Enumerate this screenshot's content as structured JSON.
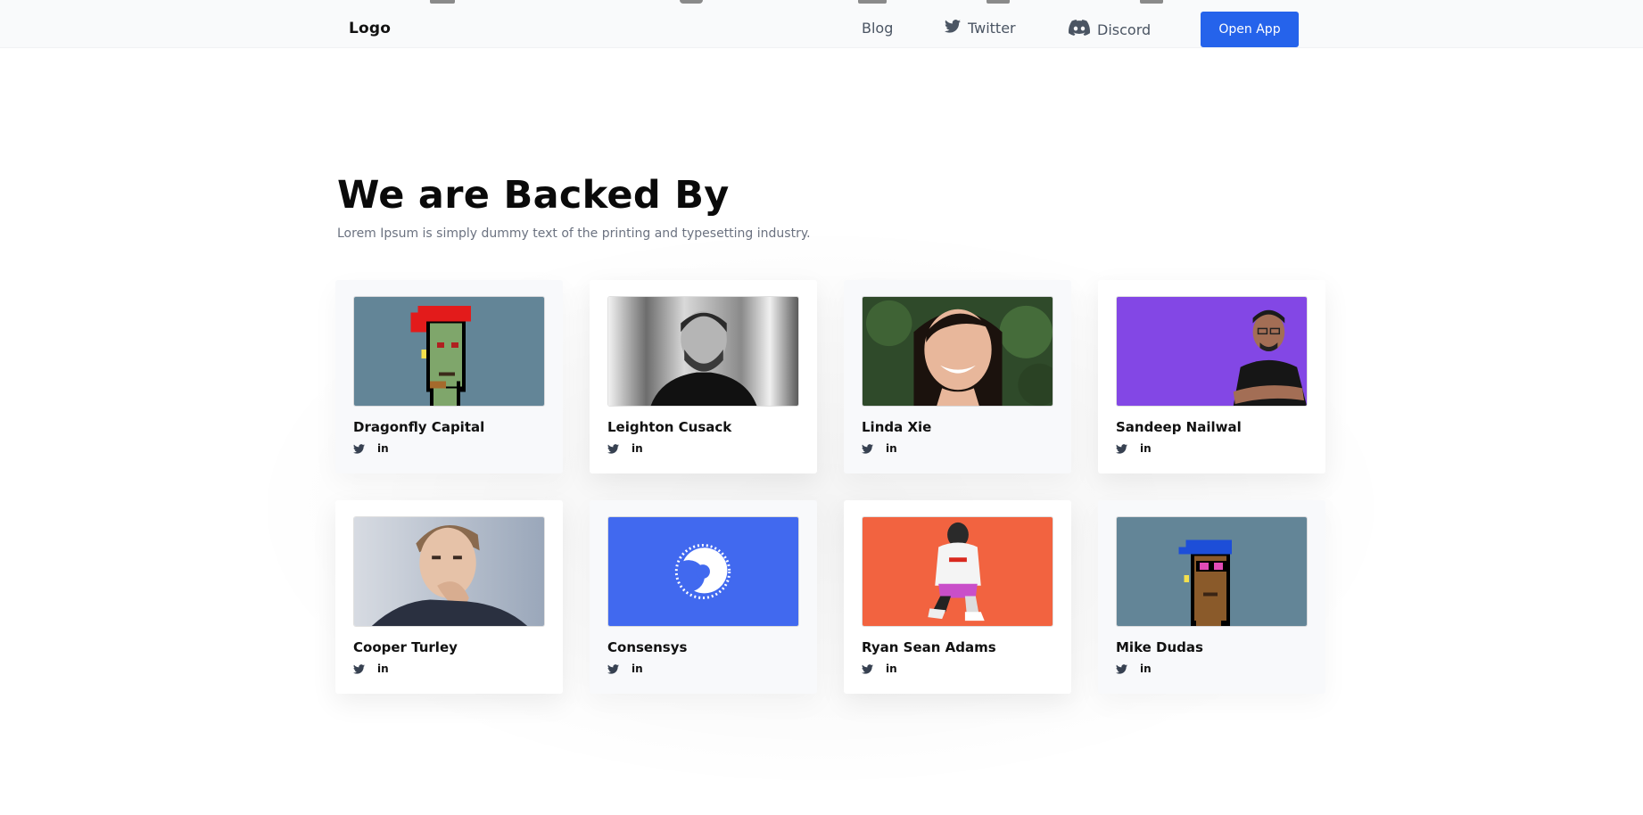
{
  "nav": {
    "logo": "Logo",
    "links": [
      {
        "label": "Blog",
        "icon": null
      },
      {
        "label": "Twitter",
        "icon": "twitter-icon"
      },
      {
        "label": "Discord",
        "icon": "discord-icon"
      }
    ],
    "cta_label": "Open App",
    "cta_color": "#2563eb"
  },
  "section": {
    "title": "We are Backed By",
    "subtitle": "Lorem Ipsum is simply dummy text of the printing and typesetting industry."
  },
  "backers": [
    {
      "name": "Dragonfly Capital",
      "photo": "pixel-punk-red-hair",
      "bg": "#638597",
      "socials": [
        "twitter-icon",
        "linkedin-icon"
      ]
    },
    {
      "name": "Leighton Cusack",
      "photo": "portrait-bw-man",
      "bg": "#e5e5e5",
      "socials": [
        "twitter-icon",
        "linkedin-icon"
      ]
    },
    {
      "name": "Linda Xie",
      "photo": "portrait-woman-foliage",
      "bg": "#2f4a2a",
      "socials": [
        "twitter-icon",
        "linkedin-icon"
      ]
    },
    {
      "name": "Sandeep Nailwal",
      "photo": "portrait-man-purple",
      "bg": "#8347e5",
      "socials": [
        "twitter-icon",
        "linkedin-icon"
      ]
    },
    {
      "name": "Cooper Turley",
      "photo": "portrait-man-hand-chin",
      "bg": "#aab4c4",
      "socials": [
        "twitter-icon",
        "linkedin-icon"
      ]
    },
    {
      "name": "Consensys",
      "photo": "consensys-logo",
      "bg": "#4169ef",
      "socials": [
        "twitter-icon",
        "linkedin-icon"
      ]
    },
    {
      "name": "Ryan Sean Adams",
      "photo": "figure-orange",
      "bg": "#f26340",
      "socials": [
        "twitter-icon",
        "linkedin-icon"
      ]
    },
    {
      "name": "Mike Dudas",
      "photo": "pixel-punk-blue-bandana",
      "bg": "#638597",
      "socials": [
        "twitter-icon",
        "linkedin-icon"
      ]
    }
  ]
}
